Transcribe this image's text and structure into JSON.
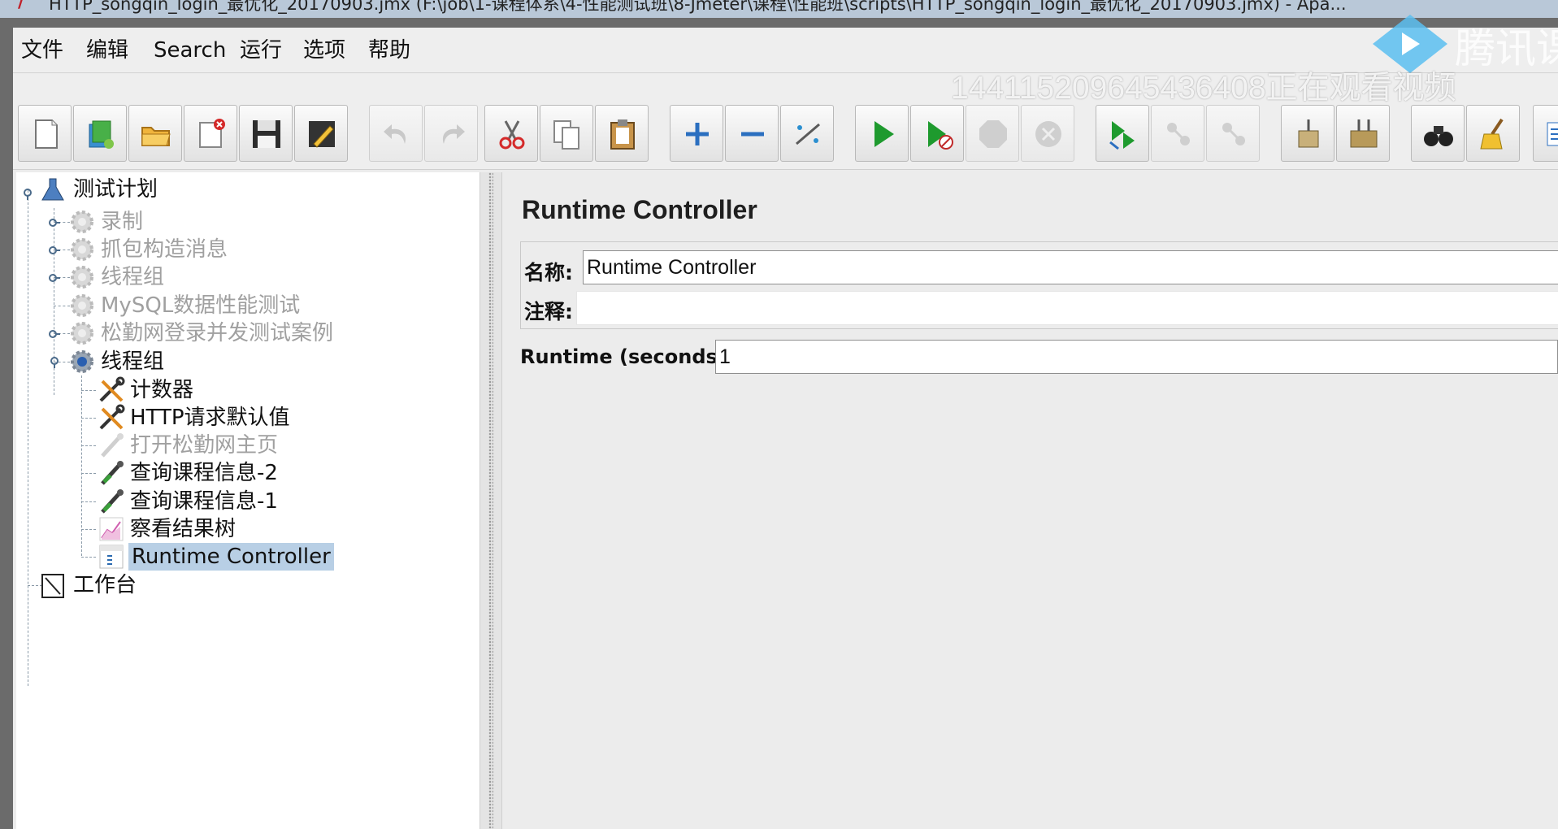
{
  "window": {
    "title": "HTTP_songqin_login_最优化_20170903.jmx (F:\\job\\1-课程体系\\4-性能测试班\\8-Jmeter\\课程\\性能班\\scripts\\HTTP_songqin_login_最优化_20170903.jmx) - Apa..."
  },
  "menubar": {
    "items": [
      "文件",
      "编辑",
      "Search",
      "运行",
      "选项",
      "帮助"
    ]
  },
  "overlay": {
    "viewer_text": "144115209645436408正在观看视频",
    "brand_text": "腾讯课"
  },
  "tree": {
    "root": "测试计划",
    "children": [
      {
        "label": "录制",
        "enabled": false
      },
      {
        "label": "抓包构造消息",
        "enabled": false
      },
      {
        "label": "线程组",
        "enabled": false
      },
      {
        "label": "MySQL数据性能测试",
        "enabled": false
      },
      {
        "label": "松勤网登录并发测试案例",
        "enabled": false
      },
      {
        "label": "线程组",
        "enabled": true
      }
    ],
    "thread_group_children": [
      {
        "label": "计数器",
        "enabled": true,
        "icon": "config-tools-icon"
      },
      {
        "label": "HTTP请求默认值",
        "enabled": true,
        "icon": "config-tools-icon"
      },
      {
        "label": "打开松勤网主页",
        "enabled": false,
        "icon": "sampler-pipette-icon"
      },
      {
        "label": "查询课程信息-2",
        "enabled": true,
        "icon": "sampler-pipette-icon"
      },
      {
        "label": "查询课程信息-1",
        "enabled": true,
        "icon": "sampler-pipette-icon"
      },
      {
        "label": "察看结果树",
        "enabled": true,
        "icon": "listener-graph-icon"
      },
      {
        "label": "Runtime Controller",
        "enabled": true,
        "icon": "controller-icon",
        "selected": true
      }
    ],
    "workbench": "工作台"
  },
  "panel": {
    "title": "Runtime Controller",
    "name_label": "名称:",
    "name_value": "Runtime Controller",
    "comment_label": "注释:",
    "comment_value": "",
    "runtime_label": "Runtime (seconds)",
    "runtime_value": "1"
  }
}
